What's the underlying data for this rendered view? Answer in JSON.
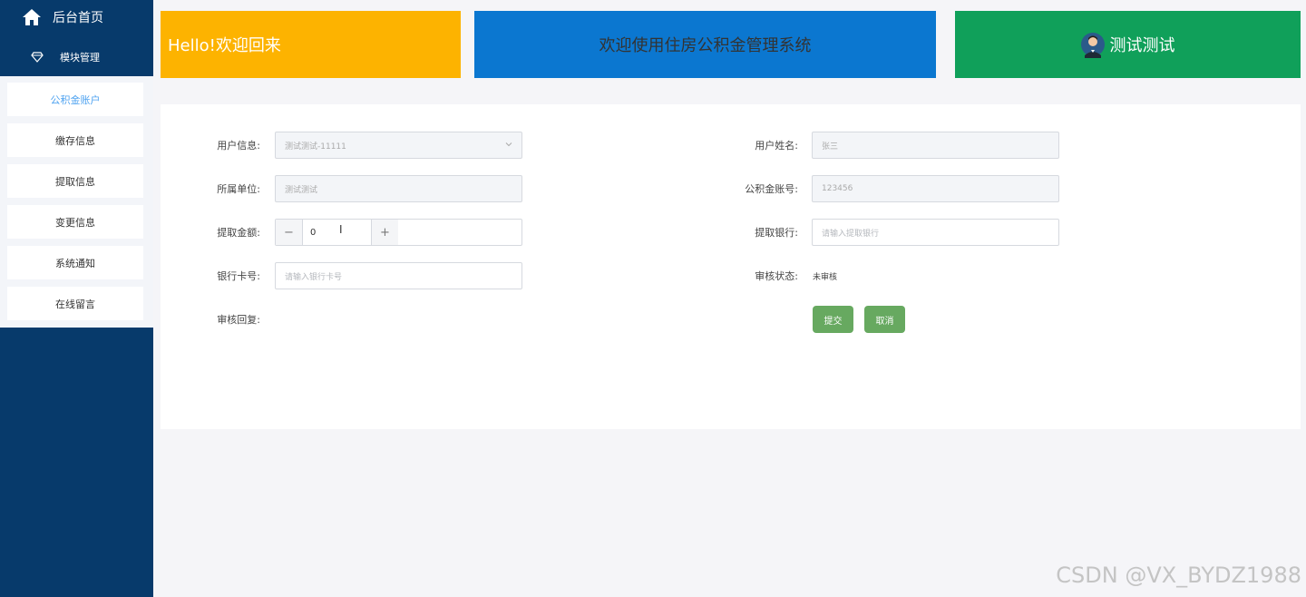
{
  "sidebar": {
    "home_label": "后台首页",
    "module_label": "模块管理",
    "items": [
      {
        "label": "公积金账户",
        "active": true
      },
      {
        "label": "缴存信息"
      },
      {
        "label": "提取信息"
      },
      {
        "label": "变更信息"
      },
      {
        "label": "系统通知"
      },
      {
        "label": "在线留言"
      }
    ]
  },
  "banners": {
    "welcome": "Hello!欢迎回来",
    "system_title": "欢迎使用住房公积金管理系统",
    "username": "测试测试"
  },
  "form": {
    "user_info_label": "用户信息:",
    "user_info_value": "测试测试-11111",
    "user_name_label": "用户姓名:",
    "user_name_value": "张三",
    "unit_label": "所属单位:",
    "unit_value": "测试测试",
    "account_label": "公积金账号:",
    "account_value": "123456",
    "amount_label": "提取金额:",
    "amount_value": "0",
    "amount_minus": "−",
    "amount_plus": "+",
    "bank_label": "提取银行:",
    "bank_placeholder": "请输入提取银行",
    "card_label": "银行卡号:",
    "card_placeholder": "请输入银行卡号",
    "review_status_label": "审核状态:",
    "review_status_value": "未审核",
    "review_reply_label": "审核回复:",
    "submit_label": "提交",
    "cancel_label": "取消"
  },
  "watermark": "CSDN @VX_BYDZ1988",
  "colors": {
    "sidebar": "#073a6b",
    "yellow": "#fdb300",
    "blue": "#0b77d0",
    "green": "#10a05a",
    "button": "#67a960"
  }
}
